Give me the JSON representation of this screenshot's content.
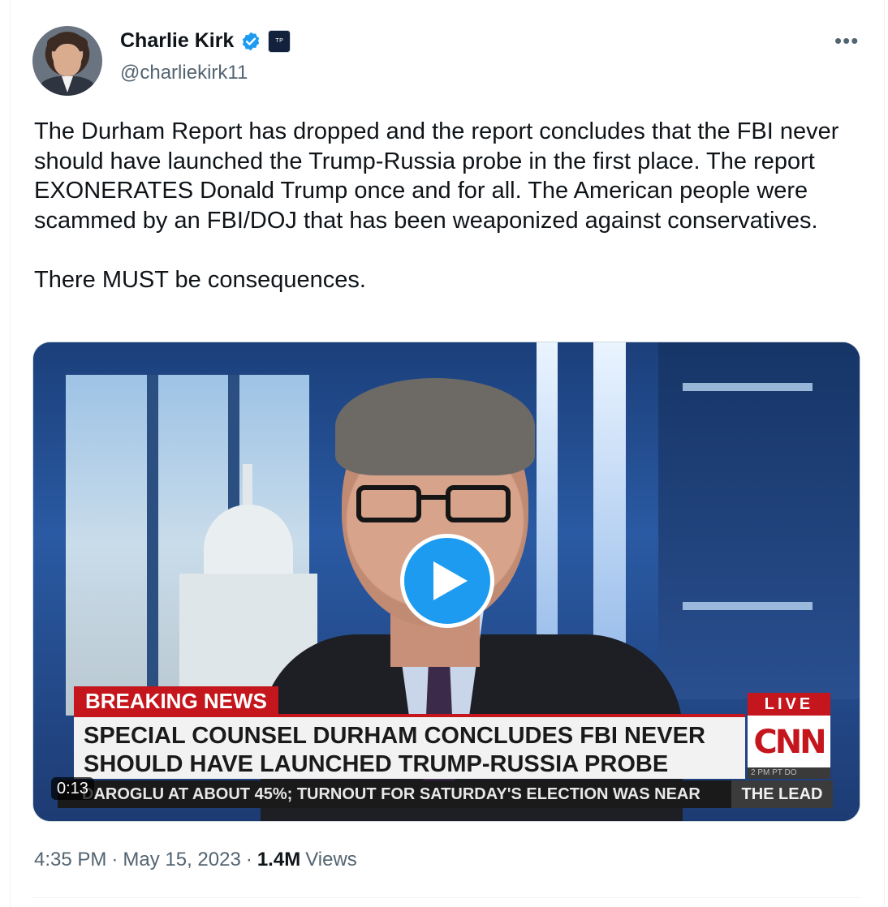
{
  "author": {
    "name": "Charlie Kirk",
    "handle": "@charliekirk11",
    "verified_icon": "verified-badge-icon",
    "affiliation_badge": "affiliate-badge-icon"
  },
  "tweet": {
    "paragraph1": "The Durham Report has dropped and the report concludes that the FBI never should have launched the Trump-Russia probe in the first place. The report EXONERATES Donald Trump once and for all. The American people were scammed by an FBI/DOJ that has been weaponized against conservatives.",
    "paragraph2": "There MUST be consequences."
  },
  "media": {
    "breaking_label": "BREAKING NEWS",
    "headline_line1": "SPECIAL COUNSEL DURHAM CONCLUDES FBI NEVER",
    "headline_line2": "SHOULD HAVE LAUNCHED TRUMP-RUSSIA PROBE",
    "live_label": "LIVE",
    "network_logo": "CNN",
    "small_row": "2 PM PT   DO",
    "ticker_text": "DAROGLU AT ABOUT 45%; TURNOUT FOR SATURDAY'S ELECTION WAS NEAR",
    "show_name": "THE LEAD",
    "timecode": "0:13"
  },
  "meta": {
    "time": "4:35 PM",
    "separator": "·",
    "date": "May 15, 2023",
    "views_count": "1.4M",
    "views_label": "Views"
  },
  "colors": {
    "accent": "#1d9bf0",
    "text_primary": "#0f1419",
    "text_secondary": "#536471",
    "cnn_red": "#c4161c"
  }
}
